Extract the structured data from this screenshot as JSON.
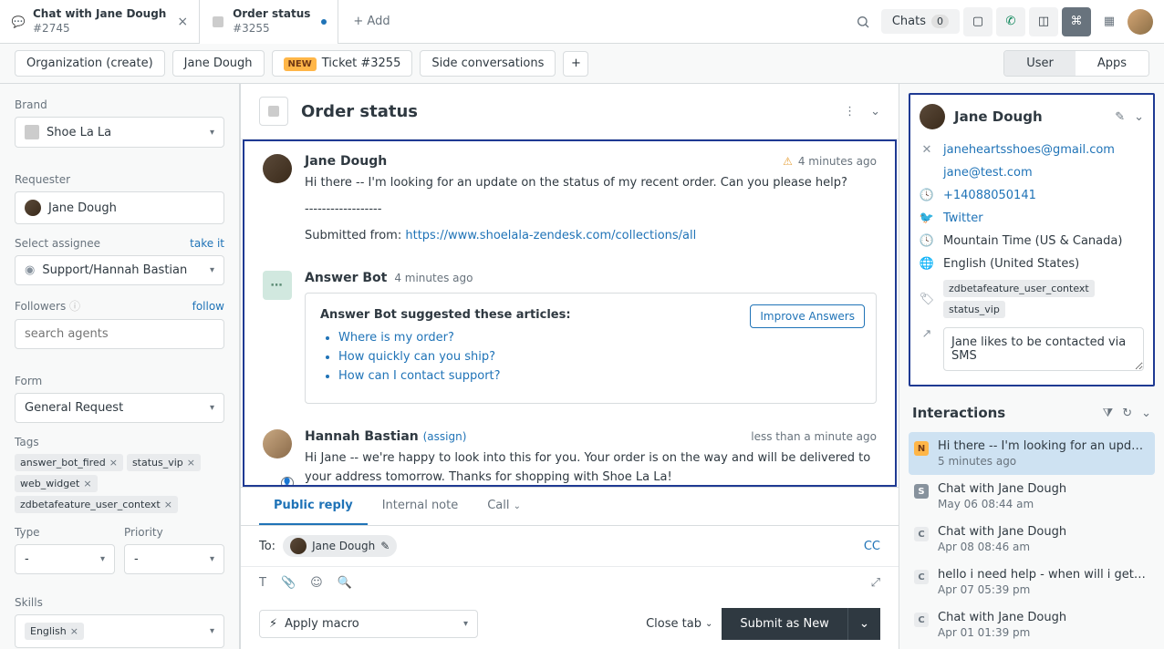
{
  "topbar": {
    "tabs": [
      {
        "title": "Chat with Jane Dough",
        "sub": "#2745",
        "icon": "chat"
      },
      {
        "title": "Order status",
        "sub": "#3255",
        "icon": "ticket",
        "unsaved": true
      }
    ],
    "add_label": "+ Add",
    "chats_label": "Chats",
    "chats_count": "0"
  },
  "subbar": {
    "tabs": [
      "Organization (create)",
      "Jane Dough"
    ],
    "ticket_tab_label": "Ticket #3255",
    "new_badge": "NEW",
    "side_label": "Side conversations",
    "view_user": "User",
    "view_apps": "Apps"
  },
  "sidebar": {
    "brand_label": "Brand",
    "brand_value": "Shoe La La",
    "requester_label": "Requester",
    "requester_value": "Jane Dough",
    "assignee_label": "Select assignee",
    "assignee_link": "take it",
    "assignee_value": "Support/Hannah Bastian",
    "followers_label": "Followers",
    "followers_link": "follow",
    "followers_placeholder": "search agents",
    "form_label": "Form",
    "form_value": "General Request",
    "tags_label": "Tags",
    "tags": [
      "answer_bot_fired",
      "status_vip",
      "web_widget",
      "zdbetafeature_user_context"
    ],
    "type_label": "Type",
    "type_value": "-",
    "priority_label": "Priority",
    "priority_value": "-",
    "skills_label": "Skills",
    "skills_value": "English"
  },
  "ticket": {
    "title": "Order status",
    "messages": {
      "m0": {
        "name": "Jane Dough",
        "time": "4 minutes ago",
        "text": "Hi there -- I'm looking for an update on the status of my recent order. Can you please help?",
        "submitted_label": "Submitted from:",
        "submitted_url": "https://www.shoelala-zendesk.com/collections/all"
      },
      "m1": {
        "name": "Answer Bot",
        "time": "4 minutes ago",
        "suggest_title": "Answer Bot suggested these articles:",
        "improve_label": "Improve Answers",
        "articles": [
          "Where is my order?",
          "How quickly can you ship?",
          "How can I contact support?"
        ]
      },
      "m2": {
        "name": "Hannah Bastian",
        "assign_label": "(assign)",
        "time": "less than a minute ago",
        "text": "Hi Jane -- we're happy to look into this for you. Your order is on the way and will be delivered to your address tomorrow. Thanks for shopping with Shoe La La!"
      }
    }
  },
  "composer": {
    "tab_public": "Public reply",
    "tab_internal": "Internal note",
    "tab_call": "Call",
    "to_label": "To:",
    "to_value": "Jane Dough",
    "cc_label": "CC",
    "macro_label": "Apply macro",
    "close_tab_label": "Close tab",
    "submit_label": "Submit as New"
  },
  "user": {
    "name": "Jane Dough",
    "email1": "janeheartsshoes@gmail.com",
    "email2": "jane@test.com",
    "phone": "+14088050141",
    "twitter": "Twitter",
    "timezone": "Mountain Time (US & Canada)",
    "language": "English (United States)",
    "tags": [
      "zdbetafeature_user_context",
      "status_vip"
    ],
    "notes": "Jane likes to be contacted via SMS"
  },
  "interactions": {
    "title": "Interactions",
    "items": [
      {
        "badge": "N",
        "text": "Hi there -- I'm looking for an update on...",
        "meta": "5 minutes ago"
      },
      {
        "badge": "S",
        "text": "Chat with Jane Dough",
        "meta": "May 06 08:44 am"
      },
      {
        "badge": "C",
        "text": "Chat with Jane Dough",
        "meta": "Apr 08 08:46 am"
      },
      {
        "badge": "C",
        "text": "hello i need help - when will i get my re...",
        "meta": "Apr 07 05:39 pm"
      },
      {
        "badge": "C",
        "text": "Chat with Jane Dough",
        "meta": "Apr 01 01:39 pm"
      }
    ]
  }
}
